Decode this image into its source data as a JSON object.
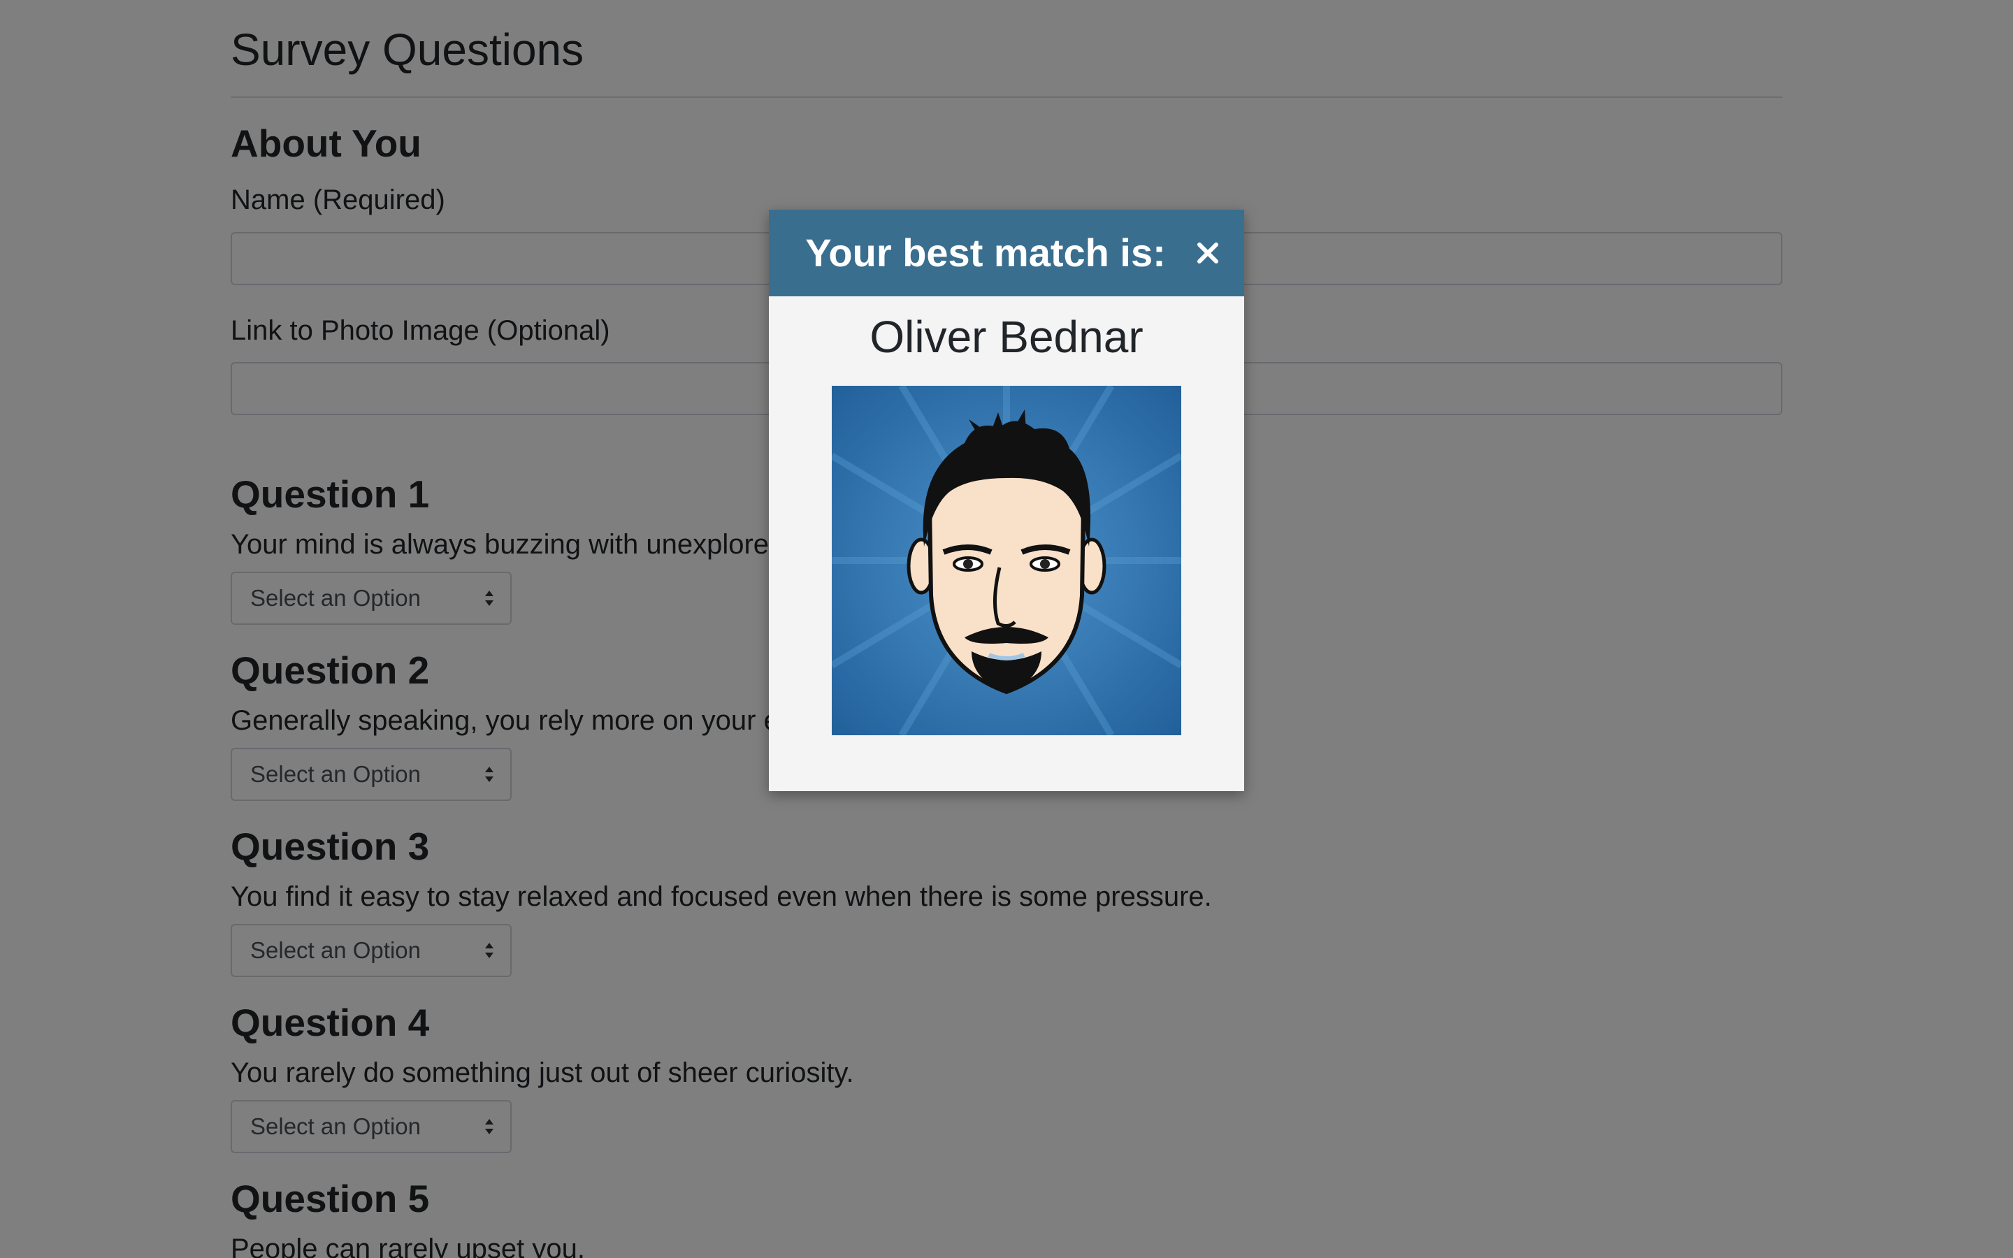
{
  "page": {
    "title": "Survey Questions"
  },
  "about": {
    "heading": "About You",
    "name_label": "Name (Required)",
    "name_value": "",
    "photo_label": "Link to Photo Image (Optional)",
    "photo_value": ""
  },
  "questions": [
    {
      "heading": "Question 1",
      "text": "Your mind is always buzzing with unexplored ideas and plans.",
      "selected": "Select an Option"
    },
    {
      "heading": "Question 2",
      "text": "Generally speaking, you rely more on your experience than your imagination.",
      "selected": "Select an Option"
    },
    {
      "heading": "Question 3",
      "text": "You find it easy to stay relaxed and focused even when there is some pressure.",
      "selected": "Select an Option"
    },
    {
      "heading": "Question 4",
      "text": "You rarely do something just out of sheer curiosity.",
      "selected": "Select an Option"
    },
    {
      "heading": "Question 5",
      "text": "People can rarely upset you.",
      "selected": "Select an Option"
    }
  ],
  "modal": {
    "title": "Your best match is:",
    "close_icon": "close-icon",
    "match_name": "Oliver Bednar",
    "photo_icon": "avatar-illustration"
  },
  "colors": {
    "modal_header": "#3a6e8f",
    "modal_body": "#f4f4f4",
    "overlay": "rgba(0,0,0,0.5)",
    "avatar_background": "#2f6fa6"
  }
}
